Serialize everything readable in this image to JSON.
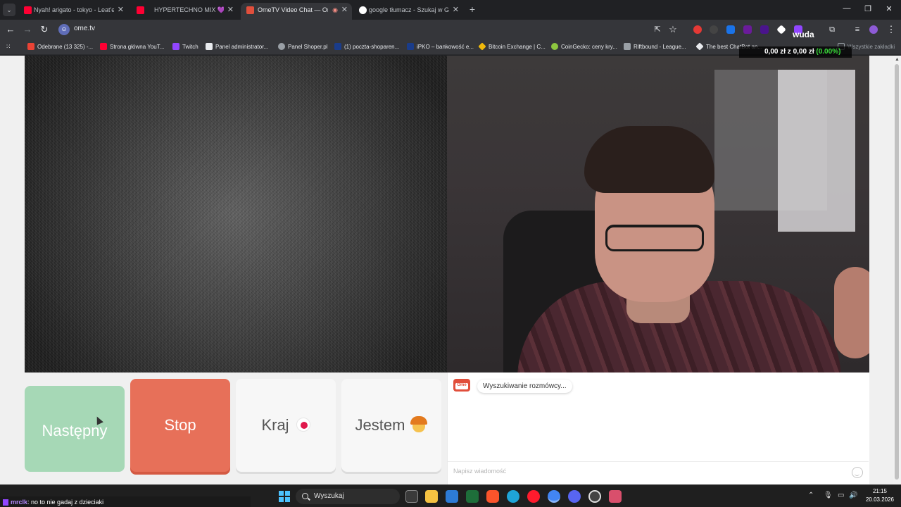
{
  "browser": {
    "tabs": [
      {
        "title": "Nyah! arigato - tokyo - Leat'eq",
        "favicon_color": "#ff0033"
      },
      {
        "title": "HYPERTECHNO MIX 💜 - Y",
        "favicon_color": "#ff0033"
      },
      {
        "title": "OmeTV Video Chat — Ome",
        "favicon_color": "#e14f3c"
      },
      {
        "title": "google tłumacz - Szukaj w Goo",
        "favicon_color": "#ffffff"
      }
    ],
    "url": "ome.tv",
    "new_tab_symbol": "+",
    "close_symbol": "✕"
  },
  "bookmarks": [
    {
      "label": "Odebrane (13 325) -...",
      "color": "#ea4335"
    },
    {
      "label": "Strona główna YouT...",
      "color": "#ff0033"
    },
    {
      "label": "Twitch",
      "color": "#9146ff"
    },
    {
      "label": "Panel administrator...",
      "color": "#e8eaed"
    },
    {
      "label": "Panel Shoper.pl",
      "color": "#9aa0a6"
    },
    {
      "label": "(1) poczta-shoparen...",
      "color": "#1a3c8a"
    },
    {
      "label": "iPKO – bankowość e...",
      "color": "#1a3c8a"
    },
    {
      "label": "Bitcoin Exchange | C...",
      "color": "#f0b90b"
    },
    {
      "label": "CoinGecko: ceny kry...",
      "color": "#8dc63f"
    },
    {
      "label": "Riftbound - League...",
      "color": "#9aa0a6"
    },
    {
      "label": "The best ChatBot an...",
      "color": "#e8eaed"
    },
    {
      "label": "Wszystkie zakładki",
      "color": "#9aa0a6"
    }
  ],
  "overlay": {
    "price": "0,00 zł z 0,00 zł",
    "percent": "(0.00%)",
    "brand": "wuda"
  },
  "controls": {
    "next_label": "Następny",
    "stop_label": "Stop",
    "country_label": "Kraj",
    "me_label": "Jestem"
  },
  "chat": {
    "logo_text": "Ome",
    "status_message": "Wyszukiwanie rozmówcy...",
    "input_placeholder": "Napisz wiadomość"
  },
  "stream_ticker": {
    "user": "mrclk",
    "message": ": no to nie gadaj z dzieciaki"
  },
  "taskbar": {
    "search_label": "Wyszukaj",
    "time": "21:15",
    "date": "20.03.2026"
  }
}
